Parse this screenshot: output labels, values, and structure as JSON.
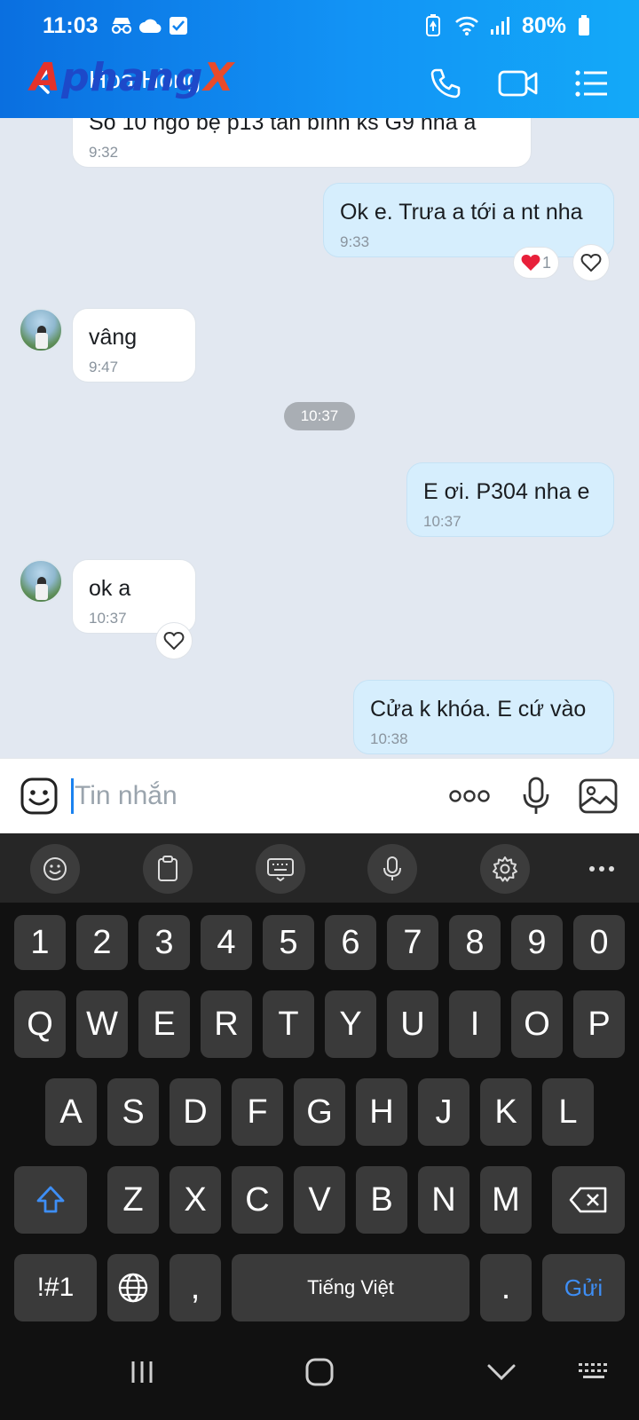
{
  "status_bar": {
    "time": "11:03",
    "battery": "80%"
  },
  "header": {
    "contact_name": "Hoa Hồng",
    "watermark": [
      "A",
      "phang",
      "X"
    ]
  },
  "messages": [
    {
      "text": "Số 10 ngõ bệ p13 tân bình ks G9 nha a",
      "time": "9:32"
    },
    {
      "text": "Ok e. Trưa a tới a nt nha",
      "time": "9:33",
      "reaction_count": "1"
    },
    {
      "text": "vâng",
      "time": "9:47"
    },
    {
      "text": "E ơi. P304 nha e",
      "time": "10:37"
    },
    {
      "text": "ok a",
      "time": "10:37"
    },
    {
      "text": "Cửa k khóa. E cứ vào",
      "time": "10:38"
    }
  ],
  "time_divider": "10:37",
  "composer": {
    "placeholder": "Tin nhắn"
  },
  "keyboard": {
    "row_numbers": [
      "1",
      "2",
      "3",
      "4",
      "5",
      "6",
      "7",
      "8",
      "9",
      "0"
    ],
    "row1": [
      "Q",
      "W",
      "E",
      "R",
      "T",
      "Y",
      "U",
      "I",
      "O",
      "P"
    ],
    "row2": [
      "A",
      "S",
      "D",
      "F",
      "G",
      "H",
      "J",
      "K",
      "L"
    ],
    "row3": [
      "Z",
      "X",
      "C",
      "V",
      "B",
      "N",
      "M"
    ],
    "symbols_key": "!#1",
    "comma_key": ",",
    "space_label": "Tiếng Việt",
    "period_key": ".",
    "send_label": "Gửi"
  },
  "colors": {
    "header_gradient_start": "#0a6fe0",
    "header_gradient_end": "#13a9f8",
    "chat_background": "#e2e8f1",
    "outgoing_bubble": "#d6eefd",
    "incoming_bubble": "#ffffff",
    "reaction_heart": "#e8203a",
    "keyboard_background": "#111111",
    "key_background": "#3a3a3a",
    "send_key_text": "#3e8ef5"
  }
}
